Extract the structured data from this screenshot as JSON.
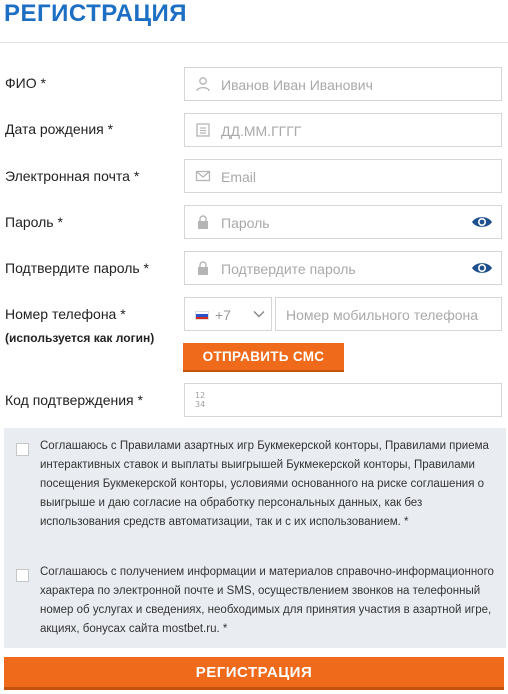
{
  "title": "РЕГИСТРАЦИЯ",
  "fields": [
    {
      "label": "ФИО *",
      "placeholder": "Иванов Иван Иванович",
      "icon": "user-icon"
    },
    {
      "label": "Дата рождения *",
      "placeholder": "ДД.ММ.ГГГГ",
      "icon": "calendar-icon"
    },
    {
      "label": "Электронная почта *",
      "placeholder": "Email",
      "icon": "mail-icon"
    },
    {
      "label": "Пароль *",
      "placeholder": "Пароль",
      "icon": "lock-icon"
    },
    {
      "label": "Подтвердите пароль *",
      "placeholder": "Подтвердите пароль",
      "icon": "lock-icon"
    }
  ],
  "phone": {
    "label": "Номер телефона *",
    "sublabel": "(используется как логин)",
    "country_code": "+7",
    "placeholder": "Номер мобильного телефона",
    "send_sms_label": "ОТПРАВИТЬ СМС"
  },
  "confirmation": {
    "label": "Код подтверждения *",
    "icon_text_top": "12",
    "icon_text_bottom": "34"
  },
  "consents": [
    "Соглашаюсь с Правилами азартных игр Букмекерской конторы, Правилами приема интерактивных ставок и выплаты выигрышей Букмекерской конторы, Правилами посещения Букмекерской конторы, условиями основанного на риске соглашения о выигрыше и даю согласие на обработку персональных данных, как без использования средств автоматизации, так и с их использованием. *",
    "Соглашаюсь с получением информации и материалов справочно-информационного характера по электронной почте и SMS, осуществлением звонков на телефонный номер об услугах и сведениях, необходимых для принятия участия в азартной игре, акциях, бонусах сайта mostbet.ru. *"
  ],
  "register_label": "РЕГИСТРАЦИЯ",
  "colors": {
    "accent": "#1d6fc4",
    "button": "#ef6a1a",
    "eye": "#1f4f8f"
  }
}
